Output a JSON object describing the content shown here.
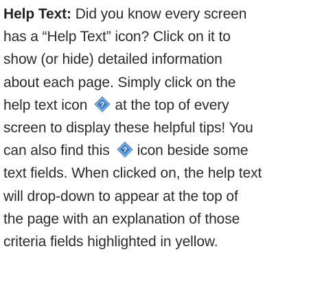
{
  "help": {
    "term": "Help Text:",
    "lines": [
      " Did you know every screen",
      "has a “Help Text” icon? Click on it to",
      "show (or hide) detailed information",
      "about each page. Simply click on the",
      "help text icon",
      "at the top of every",
      "screen to display these helpful tips! You",
      "can also find this",
      "icon beside some",
      "text fields. When clicked on, the help text",
      "will drop-down to appear at the top of",
      "the page with an explanation of those",
      "criteria fields highlighted in yellow."
    ],
    "icon": "help-diamond-icon",
    "icon_colors": {
      "outer": "#5b9bd5",
      "inner": "#2f6fb3",
      "glyph": "#ffffff"
    }
  }
}
